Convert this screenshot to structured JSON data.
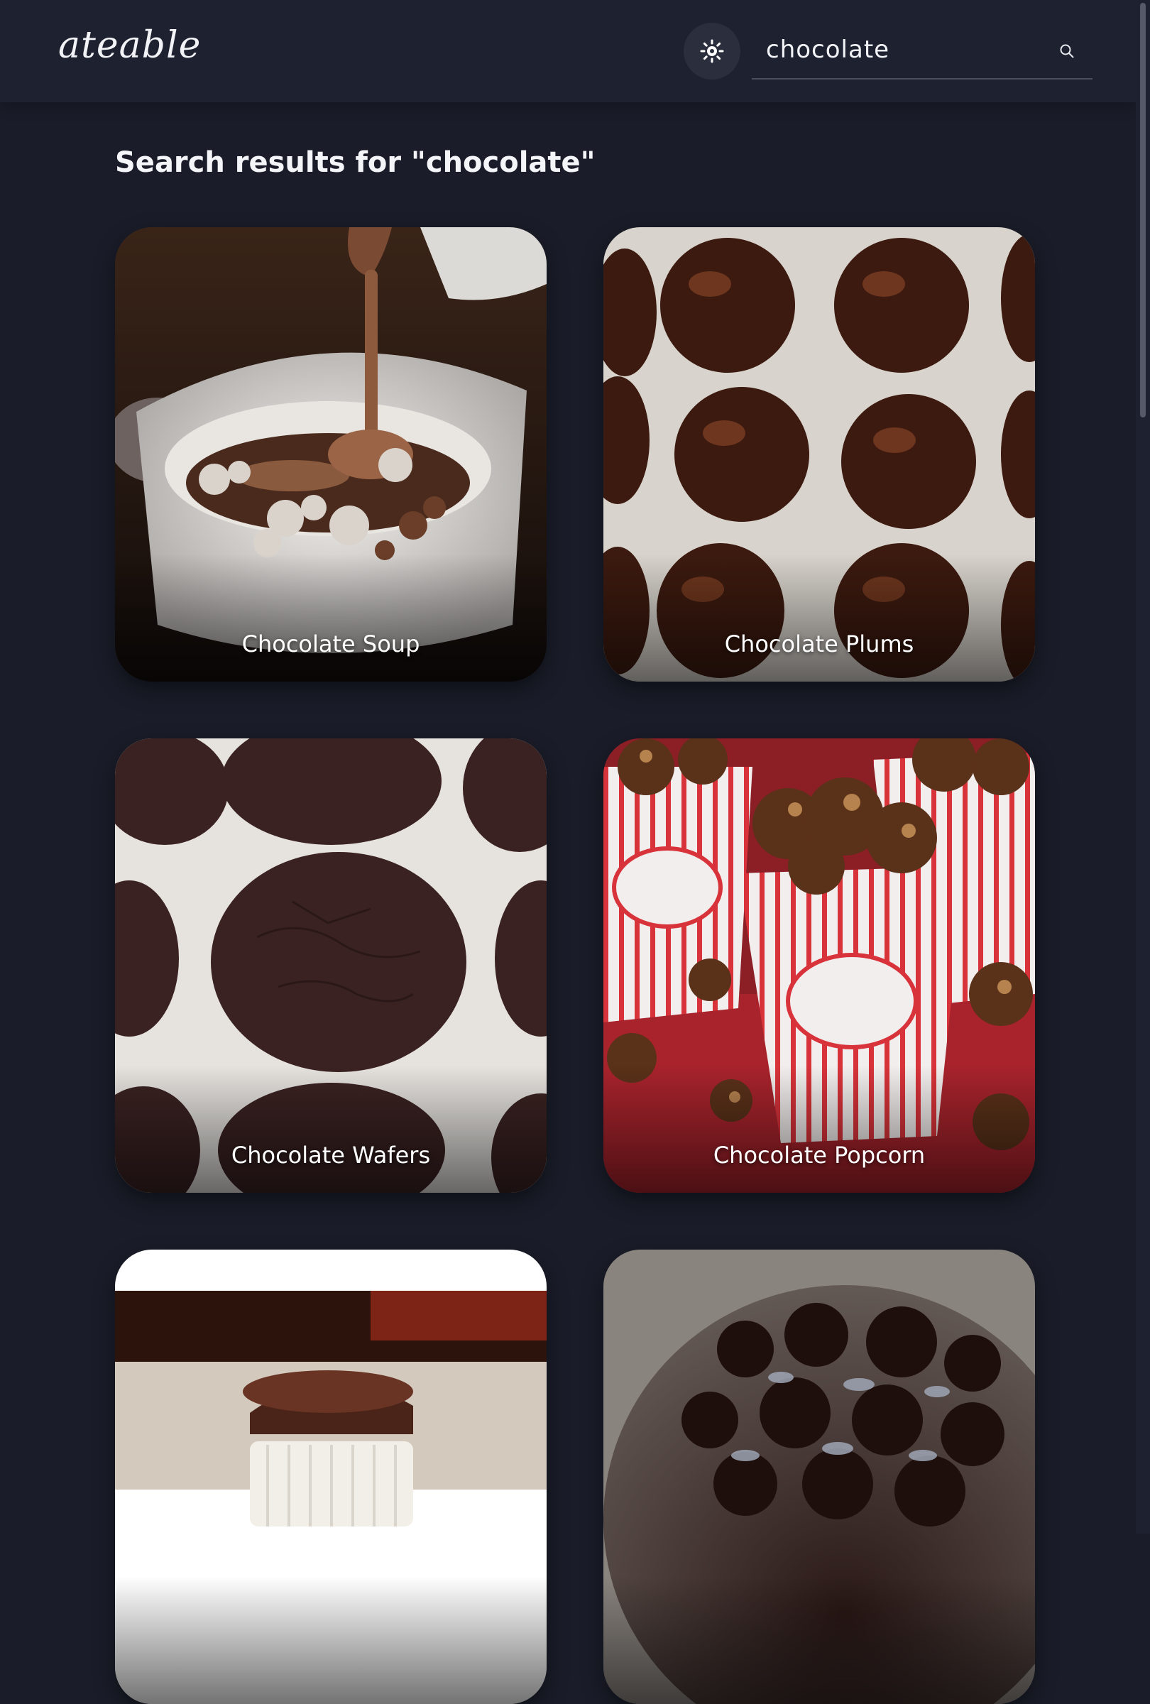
{
  "header": {
    "logo": "ateable",
    "theme_toggle_icon": "sun-icon",
    "search": {
      "value": "chocolate",
      "icon": "search-icon"
    }
  },
  "results": {
    "heading": "Search results for \"chocolate\"",
    "items": [
      {
        "title": "Chocolate Soup"
      },
      {
        "title": "Chocolate Plums"
      },
      {
        "title": "Chocolate Wafers"
      },
      {
        "title": "Chocolate Popcorn"
      },
      {
        "title": ""
      },
      {
        "title": ""
      }
    ]
  },
  "colors": {
    "background": "#1a1d29",
    "header_background": "#1d2130",
    "text": "#eef0f4"
  }
}
